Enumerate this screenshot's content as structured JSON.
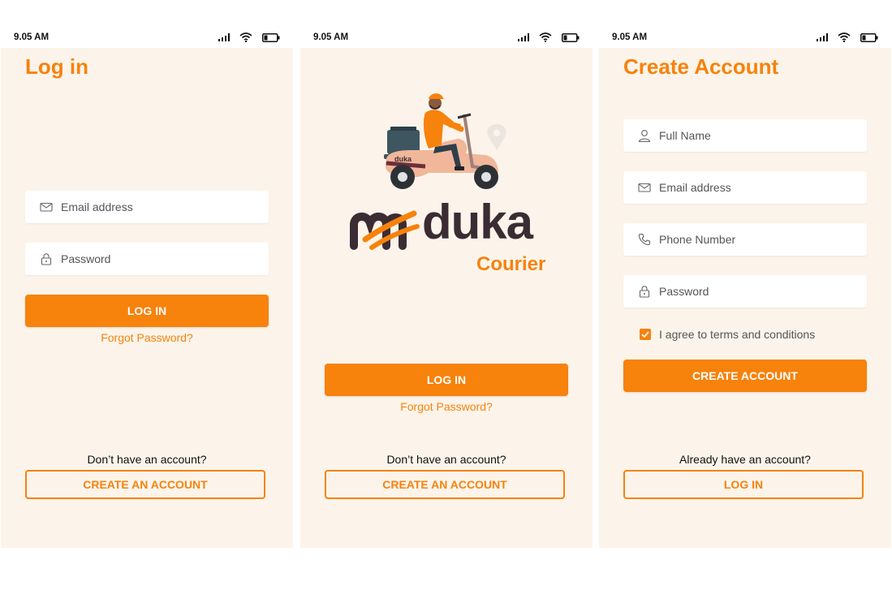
{
  "screens": {
    "login": {
      "status": {
        "time": "9.05 AM"
      },
      "title": "Log in",
      "email_placeholder": "Email address",
      "password_placeholder": "Password",
      "login_label": "LOG IN",
      "forgot_label": "Forgot Password?",
      "no_account_text": "Don’t have an account?",
      "create_label": "CREATE AN ACCOUNT"
    },
    "splash": {
      "status": {
        "time": "9.05 AM"
      },
      "logo_text": "duka",
      "scooter_logo_text": "duka",
      "courier_text": "Courier",
      "login_label": "LOG IN",
      "forgot_label": "Forgot Password?",
      "no_account_text": "Don’t have an account?",
      "create_label": "CREATE AN ACCOUNT"
    },
    "signup": {
      "status": {
        "time": "9.05 AM"
      },
      "title": "Create Account",
      "fullname_placeholder": "Full Name",
      "email_placeholder": "Email address",
      "phone_placeholder": "Phone Number",
      "password_placeholder": "Password",
      "terms_label": "I agree to terms and conditions",
      "terms_checked": true,
      "create_label": "CREATE ACCOUNT",
      "have_account_text": "Already have an account?",
      "login_label": "LOG IN"
    }
  },
  "colors": {
    "accent": "#f7820c",
    "panel": "#fcf4ea",
    "brand_dark": "#3b2c34"
  },
  "icons": [
    "signal-icon",
    "wifi-icon",
    "battery-icon",
    "mail-icon",
    "lock-icon",
    "user-icon",
    "phone-icon",
    "check-icon",
    "location-pin-icon"
  ]
}
